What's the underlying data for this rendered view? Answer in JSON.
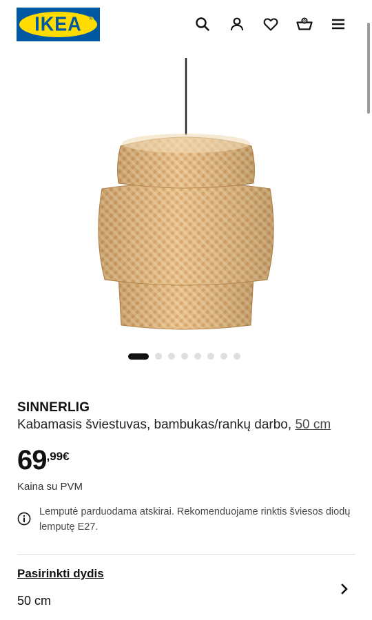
{
  "brand": {
    "logo_text": "IKEA",
    "registered_mark": "®"
  },
  "header_icons": [
    "search-icon",
    "user-icon",
    "heart-icon",
    "basket-icon",
    "menu-icon"
  ],
  "header": {
    "basket_count": "0"
  },
  "carousel": {
    "total": 8,
    "active_index": 0
  },
  "product": {
    "name": "SINNERLIG",
    "description": "Kabamasis šviestuvas, bambukas/rankų darbo, ",
    "size_link": "50 cm"
  },
  "price": {
    "integer": "69",
    "decimal": ",99",
    "currency": "€",
    "vat_note": "Kaina su PVM"
  },
  "info": {
    "text": "Lemputė parduodama atskirai. Rekomenduojame rinktis šviesos diodų lemputę E27."
  },
  "size_selector": {
    "title": "Pasirinkti dydis",
    "value": "50 cm"
  },
  "colors": {
    "ikea_blue": "#0058a3",
    "ikea_yellow": "#ffdb00",
    "bamboo": "#d9a86b"
  }
}
